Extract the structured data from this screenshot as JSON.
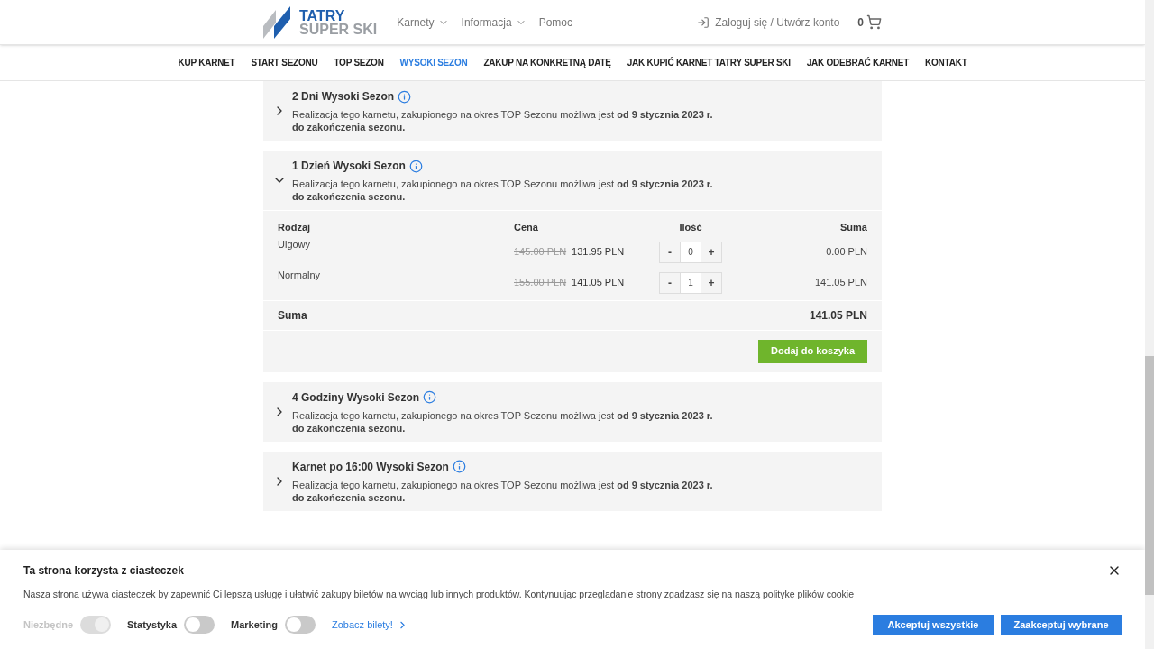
{
  "header": {
    "logo": {
      "line1": "TATRY",
      "line2": "SUPER SKI"
    },
    "menu": [
      {
        "label": "Karnety",
        "has_dropdown": true
      },
      {
        "label": "Informacja",
        "has_dropdown": true
      },
      {
        "label": "Pomoc",
        "has_dropdown": false
      }
    ],
    "login": "Zaloguj się / Utwórz konto",
    "cart_count": "0"
  },
  "nav": [
    {
      "label": "KUP KARNET",
      "selected": false
    },
    {
      "label": "START SEZONU",
      "selected": false
    },
    {
      "label": "TOP SEZON",
      "selected": false
    },
    {
      "label": "WYSOKI SEZON",
      "selected": true
    },
    {
      "label": "ZAKUP NA KONKRETNĄ DATĘ",
      "selected": false
    },
    {
      "label": "JAK KUPIĆ KARNET TATRY SUPER SKI",
      "selected": false
    },
    {
      "label": "JAK ODEBRAĆ KARNET",
      "selected": false
    },
    {
      "label": "KONTAKT",
      "selected": false
    }
  ],
  "passes": [
    {
      "title": "2 Dni Wysoki Sezon",
      "description": "Realizacja tego karnetu, zakupionego na okres TOP Sezonu możliwa jest **od 9 stycznia 2023 r. do zakończenia sezonu.**",
      "expanded": false
    },
    {
      "title": "1 Dzień Wysoki Sezon",
      "description": "Realizacja tego karnetu, zakupionego na okres TOP Sezonu możliwa jest **od 9 stycznia 2023 r. do zakończenia sezonu.**",
      "expanded": true,
      "table": {
        "columns": [
          "Rodzaj",
          "Cena",
          "Ilość",
          "Suma"
        ],
        "rows": [
          {
            "type": "Ulgowy",
            "old_price": "145.00 PLN",
            "price": "131.95 PLN",
            "minus": "-",
            "quantity": "0",
            "plus": "+",
            "sum": "0.00 PLN"
          },
          {
            "type": "Normalny",
            "old_price": "155.00 PLN",
            "price": "141.05 PLN",
            "minus": "-",
            "quantity": "1",
            "plus": "+",
            "sum": "141.05 PLN"
          }
        ],
        "total_label": "Suma",
        "total": "141.05 PLN",
        "add_button": "Dodaj do koszyka"
      }
    },
    {
      "title": "4 Godziny Wysoki Sezon",
      "description": "Realizacja tego karnetu, zakupionego na okres TOP Sezonu możliwa jest **od 9 stycznia 2023 r. do zakończenia sezonu.**",
      "expanded": false
    },
    {
      "title": "Karnet po 16:00 Wysoki Sezon",
      "description": "Realizacja tego karnetu, zakupionego na okres TOP Sezonu możliwa jest **od 9 stycznia 2023 r. do zakończenia sezonu.**",
      "expanded": false
    }
  ],
  "cookie": {
    "title": "Ta strona korzysta z ciasteczek",
    "text": "Nasza strona używa ciasteczek by zapewnić Ci lepszą usługę i ułatwić zakupy biletów na wyciąg lub innych produktów. Kontynuując przeglądanie strony zgadzasz się na naszą politykę plików cookie",
    "toggles": [
      {
        "label": "Niezbędne",
        "on": true,
        "disabled": true
      },
      {
        "label": "Statystyka",
        "on": false,
        "disabled": false
      },
      {
        "label": "Marketing",
        "on": false,
        "disabled": false
      }
    ],
    "link": "Zobacz bilety!",
    "buttons": [
      "Akceptuj wszystkie",
      "Zaakceptuj wybrane"
    ]
  }
}
